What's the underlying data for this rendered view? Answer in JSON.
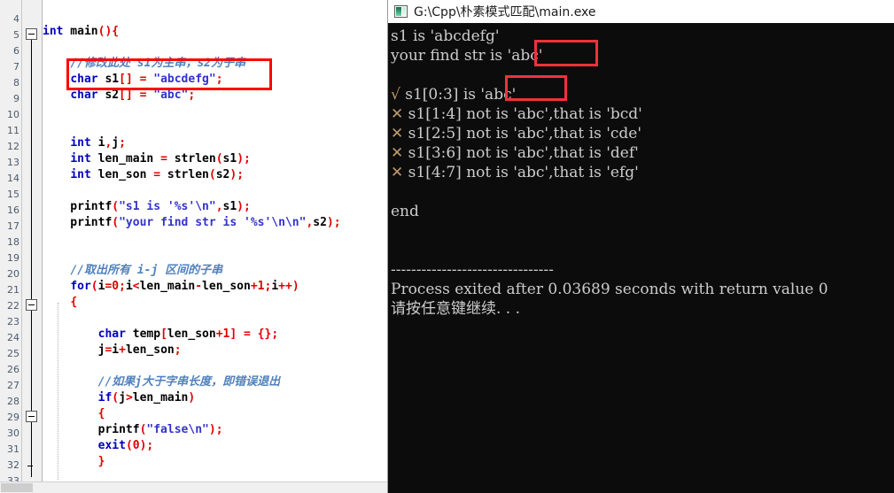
{
  "editor": {
    "first_line_number": 4,
    "last_line_number": 33,
    "lines": [
      {
        "n": 4,
        "text": ""
      },
      {
        "n": 5,
        "text": "int main(){"
      },
      {
        "n": 6,
        "text": ""
      },
      {
        "n": 7,
        "text": "    //修改此处 s1为主串，s2为子串"
      },
      {
        "n": 8,
        "text": "    char s1[] = \"abcdefg\";"
      },
      {
        "n": 9,
        "text": "    char s2[] = \"abc\";"
      },
      {
        "n": 10,
        "text": ""
      },
      {
        "n": 11,
        "text": ""
      },
      {
        "n": 12,
        "text": "    int i,j;"
      },
      {
        "n": 13,
        "text": "    int len_main = strlen(s1);"
      },
      {
        "n": 14,
        "text": "    int len_son = strlen(s2);"
      },
      {
        "n": 15,
        "text": ""
      },
      {
        "n": 16,
        "text": "    printf(\"s1 is '%s'\\n\",s1);"
      },
      {
        "n": 17,
        "text": "    printf(\"your find str is '%s'\\n\\n\",s2);"
      },
      {
        "n": 18,
        "text": ""
      },
      {
        "n": 19,
        "text": ""
      },
      {
        "n": 20,
        "text": "    //取出所有 i-j 区间的子串"
      },
      {
        "n": 21,
        "text": "    for(i=0;i<len_main-len_son+1;i++)"
      },
      {
        "n": 22,
        "text": "    {"
      },
      {
        "n": 23,
        "text": ""
      },
      {
        "n": 24,
        "text": "        char temp[len_son+1] = {};"
      },
      {
        "n": 25,
        "text": "        j=i+len_son;"
      },
      {
        "n": 26,
        "text": ""
      },
      {
        "n": 27,
        "text": "        //如果j大于字串长度，即错误退出"
      },
      {
        "n": 28,
        "text": "        if(j>len_main)"
      },
      {
        "n": 29,
        "text": "        {"
      },
      {
        "n": 30,
        "text": "        printf(\"false\\n\");"
      },
      {
        "n": 31,
        "text": "        exit(0);"
      },
      {
        "n": 32,
        "text": "        }"
      },
      {
        "n": 33,
        "text": ""
      }
    ],
    "fold_markers": [
      5,
      22,
      29
    ],
    "highlight_box_label": "char-declarations-highlight"
  },
  "console": {
    "title": "G:\\Cpp\\朴素模式匹配\\main.exe",
    "icon": "console-window-icon",
    "lines": [
      {
        "id": "l1",
        "text": "s1 is 'abcdefg'"
      },
      {
        "id": "l2",
        "text": "your find str is 'abc'"
      },
      {
        "id": "l3",
        "text": ""
      },
      {
        "id": "l4",
        "text": "√ s1[0:3] is 'abc'"
      },
      {
        "id": "l5",
        "text": "✕ s1[1:4] not is 'abc',that is 'bcd'"
      },
      {
        "id": "l6",
        "text": "✕ s1[2:5] not is 'abc',that is 'cde'"
      },
      {
        "id": "l7",
        "text": "✕ s1[3:6] not is 'abc',that is 'def'"
      },
      {
        "id": "l8",
        "text": "✕ s1[4:7] not is 'abc',that is 'efg'"
      },
      {
        "id": "l9",
        "text": ""
      },
      {
        "id": "l10",
        "text": "end"
      },
      {
        "id": "l11",
        "text": ""
      },
      {
        "id": "l12",
        "text": ""
      },
      {
        "id": "l13",
        "text": "--------------------------------"
      },
      {
        "id": "l14",
        "text": "Process exited after 0.03689 seconds with return value 0"
      },
      {
        "id": "l15",
        "text": "请按任意键继续. . ."
      }
    ],
    "highlight_boxes": [
      {
        "label": "find-str-abc-highlight",
        "text": "'abc'"
      },
      {
        "label": "substring-abc-highlight",
        "text": "'abc'"
      }
    ]
  },
  "colors": {
    "annotation_red": "#ff0000",
    "console_annotation_red": "#f0323c",
    "console_bg": "#0c0c0c",
    "console_fg": "#cccccc",
    "keyword_blue": "#0000c0",
    "punctuation_red": "#e00000",
    "string_blue": "#3333cc",
    "comment_blue": "#4f81bd",
    "gutter_bg": "#f0f0f0"
  }
}
